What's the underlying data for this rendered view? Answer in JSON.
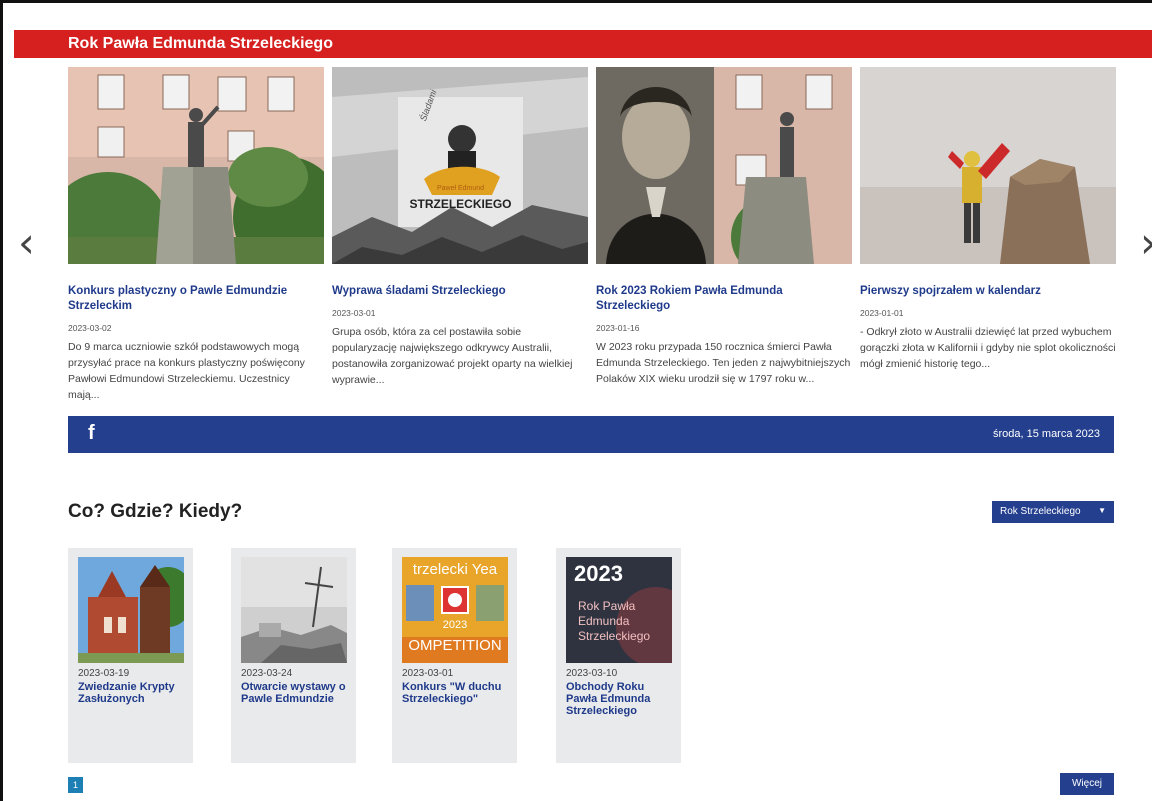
{
  "header": {
    "title": "Rok Pawła Edmunda Strzeleckiego"
  },
  "carousel": {
    "prev_icon": "chevron-left-icon",
    "next_icon": "chevron-right-icon",
    "items": [
      {
        "title": "Konkurs plastyczny o Pawle Edmundzie Strzeleckim",
        "date": "2023-03-02",
        "desc": "Do 9 marca uczniowie szkół podstawowych mogą przysyłać prace na konkurs plastyczny poświęcony Pawłowi Edmundowi Strzeleckiemu. Uczestnicy mają..."
      },
      {
        "title": "Wyprawa śladami Strzeleckiego",
        "date": "2023-03-01",
        "desc": "Grupa osób, która za cel postawiła sobie popularyzację największego odkrywcy Australii, postanowiła zorganizować projekt oparty na wielkiej wyprawie...",
        "image_text": {
          "line1": "Paweł Edmund",
          "line2": "STRZELECKIEGO",
          "script": "Śladami"
        }
      },
      {
        "title": "Rok 2023 Rokiem Pawła Edmunda Strzeleckiego",
        "date": "2023-01-16",
        "desc": "W 2023 roku przypada 150 rocznica śmierci Pawła Edmunda Strzeleckiego. Ten jeden z najwybitniejszych Polaków XIX wieku urodził się w 1797 roku w..."
      },
      {
        "title": "Pierwszy spojrzałem w kalendarz",
        "date": "2023-01-01",
        "desc": "- Odkrył złoto w Australii dziewięć lat przed wybuchem gorączki złota w Kalifornii i gdyby nie splot okoliczności mógł zmienić historię tego..."
      }
    ]
  },
  "infobar": {
    "facebook_label": "f",
    "date": "środa, 15 marca 2023"
  },
  "events": {
    "title": "Co? Gdzie? Kiedy?",
    "filter_label": "Rok Strzeleckiego",
    "items": [
      {
        "date": "2023-03-19",
        "title": "Zwiedzanie Krypty Zasłużonych"
      },
      {
        "date": "2023-03-24",
        "title": "Otwarcie wystawy o Pawle Edmundzie"
      },
      {
        "date": "2023-03-01",
        "title": "Konkurs \"W duchu Strzeleckiego\"",
        "image_text": {
          "top": "trzelecki Yea",
          "year": "2023",
          "bottom": "OMPETITION"
        }
      },
      {
        "date": "2023-03-10",
        "title": "Obchody Roku Pawła Edmunda Strzeleckiego",
        "image_text": {
          "year": "2023",
          "line1": "Rok Pawła",
          "line2": "Edmunda",
          "line3": "Strzeleckiego"
        }
      }
    ],
    "page": "1",
    "more_label": "Więcej"
  },
  "colors": {
    "red": "#d62020",
    "navy": "#243f8e",
    "link": "#1f3a8a"
  }
}
